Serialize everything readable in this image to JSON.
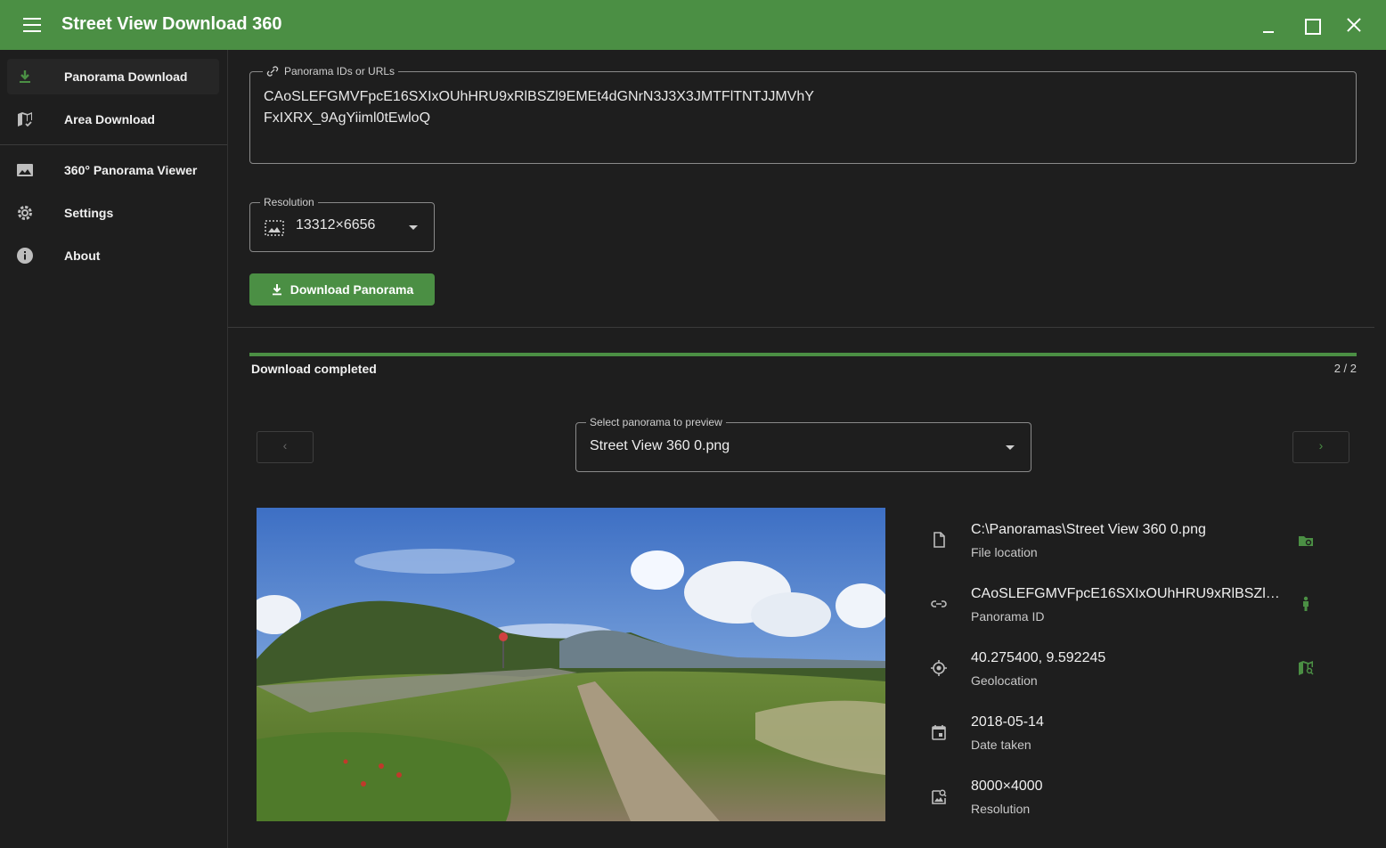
{
  "app": {
    "title": "Street View Download 360"
  },
  "sidebar": {
    "items": [
      {
        "label": "Panorama Download",
        "icon": "download-icon",
        "active": true
      },
      {
        "label": "Area Download",
        "icon": "map-check-icon",
        "active": false
      },
      {
        "label": "360° Panorama Viewer",
        "icon": "image-icon",
        "active": false
      },
      {
        "label": "Settings",
        "icon": "gear-icon",
        "active": false
      },
      {
        "label": "About",
        "icon": "info-icon",
        "active": false
      }
    ]
  },
  "ids_field": {
    "legend": "Panorama IDs or URLs",
    "value": "CAoSLEFGMVFpcE16SXIxOUhHRU9xRlBSZl9EMEt4dGNrN3J3X3JMTFlTNTJJMVhY\nFxIXRX_9AgYiiml0tEwloQ"
  },
  "resolution": {
    "legend": "Resolution",
    "value": "13312×6656"
  },
  "download_button": {
    "label": "Download Panorama"
  },
  "progress": {
    "status": "Download completed",
    "count": "2 / 2",
    "fraction": 1.0
  },
  "preview_select": {
    "legend": "Select panorama to preview",
    "value": "Street View 360 0.png"
  },
  "info": [
    {
      "primary": "C:\\Panoramas\\Street View 360 0.png",
      "secondary": "File location",
      "icon": "file-icon",
      "action_icon": "folder-search-icon"
    },
    {
      "primary": "CAoSLEFGMVFpcE16SXIxOUhHRU9xRlBSZl9E...",
      "secondary": "Panorama ID",
      "icon": "link-icon",
      "action_icon": "street-view-icon"
    },
    {
      "primary": "40.275400, 9.592245",
      "secondary": "Geolocation",
      "icon": "crosshair-icon",
      "action_icon": "map-search-icon"
    },
    {
      "primary": "2018-05-14",
      "secondary": "Date taken",
      "icon": "calendar-icon",
      "action_icon": null
    },
    {
      "primary": "8000×4000",
      "secondary": "Resolution",
      "icon": "image-search-icon",
      "action_icon": null
    }
  ],
  "colors": {
    "accent": "#4b8f44",
    "background": "#1e1e1e",
    "text": "#e6e6e6"
  }
}
